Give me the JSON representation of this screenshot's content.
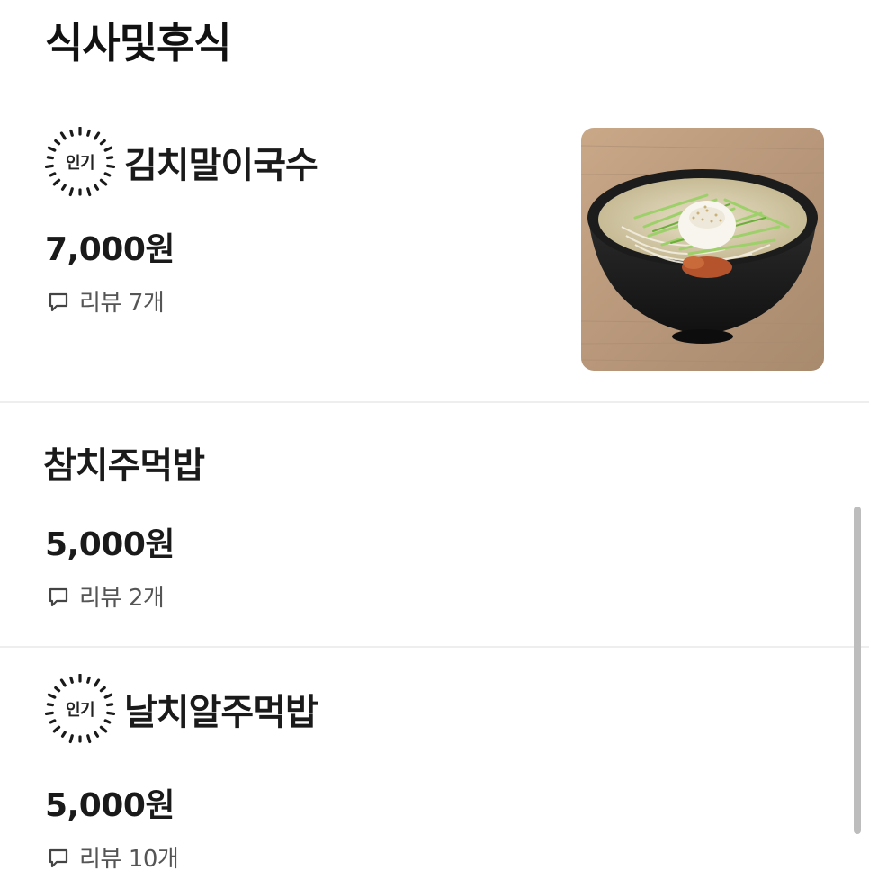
{
  "section": {
    "title": "식사및후식"
  },
  "badge_label": "인기",
  "review_label": "리뷰",
  "items": [
    {
      "name": "김치말이국수",
      "popular": true,
      "price": "7,000원",
      "review_count": "7개",
      "has_image": true
    },
    {
      "name": "참치주먹밥",
      "popular": false,
      "price": "5,000원",
      "review_count": "2개",
      "has_image": false
    },
    {
      "name": "날치알주먹밥",
      "popular": true,
      "price": "5,000원",
      "review_count": "10개",
      "has_image": false
    }
  ],
  "icons": {
    "popular_badge": "sunburst-badge-icon",
    "review": "chat-bubble-icon"
  }
}
